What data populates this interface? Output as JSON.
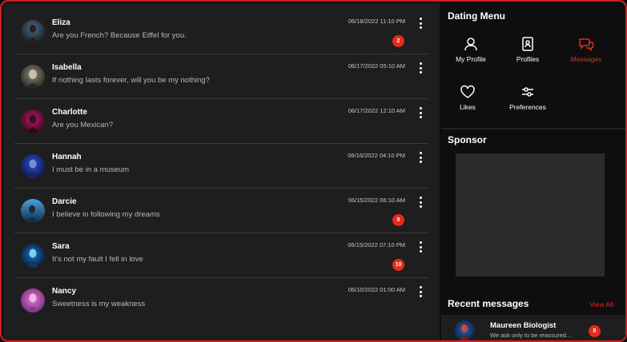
{
  "conversations": [
    {
      "name": "Eliza",
      "preview": "Are you French? Because Eiffel for you.",
      "time": "06/18/2022 11:10 PM",
      "unread": "2"
    },
    {
      "name": "Isabella",
      "preview": "If nothing lasts forever, will you be my nothing?",
      "time": "06/17/2022 05:10 AM",
      "unread": null
    },
    {
      "name": "Charlotte",
      "preview": "Are you Mexican?",
      "time": "06/17/2022 12:10 AM",
      "unread": null
    },
    {
      "name": "Hannah",
      "preview": "I must be in a museum",
      "time": "06/16/2022 04:10 PM",
      "unread": null
    },
    {
      "name": "Darcie",
      "preview": "I believe in following my dreams",
      "time": "06/15/2022 06:10 AM",
      "unread": "9"
    },
    {
      "name": "Sara",
      "preview": "It's not my fault I fell in love",
      "time": "06/15/2022 07:10 PM",
      "unread": "10"
    },
    {
      "name": "Nancy",
      "preview": "Sweetness is my weakness",
      "time": "06/10/2022 01:00 AM",
      "unread": null
    }
  ],
  "dating_menu": {
    "title": "Dating Menu",
    "items": [
      {
        "label": "My Profile",
        "icon": "user-icon",
        "active": false
      },
      {
        "label": "Profiles",
        "icon": "id-card-icon",
        "active": false
      },
      {
        "label": "Messages",
        "icon": "chat-bubbles-icon",
        "active": true
      },
      {
        "label": "Likes",
        "icon": "heart-icon",
        "active": false
      },
      {
        "label": "Preferences",
        "icon": "sliders-icon",
        "active": false
      }
    ]
  },
  "sponsor": {
    "title": "Sponsor"
  },
  "recent": {
    "title": "Recent messages",
    "view_all": "View All",
    "items": [
      {
        "name": "Maureen Biologist",
        "preview": "We ask only to be reassured...",
        "unread": "8"
      }
    ]
  },
  "colors": {
    "accent": "#e52b1c",
    "panel": "#1e1e1e",
    "background": "#0e0e0e"
  }
}
